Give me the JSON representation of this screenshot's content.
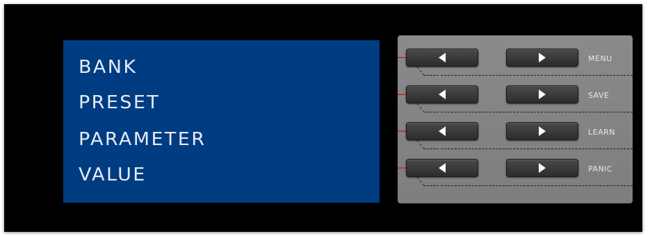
{
  "display": {
    "lines": [
      "BANK",
      "PRESET",
      "PARAMETER",
      "VALUE"
    ],
    "background": "#003c82",
    "text_color": "#e6ebf5"
  },
  "controls": {
    "rows": [
      {
        "label": "MENU",
        "left_icon": "left-arrow-icon",
        "right_icon": "right-arrow-icon"
      },
      {
        "label": "SAVE",
        "left_icon": "left-arrow-icon",
        "right_icon": "right-arrow-icon"
      },
      {
        "label": "LEARN",
        "left_icon": "left-arrow-icon",
        "right_icon": "right-arrow-icon"
      },
      {
        "label": "PANIC",
        "left_icon": "left-arrow-icon",
        "right_icon": "right-arrow-icon"
      }
    ],
    "indicator_color": "#c0392b"
  }
}
